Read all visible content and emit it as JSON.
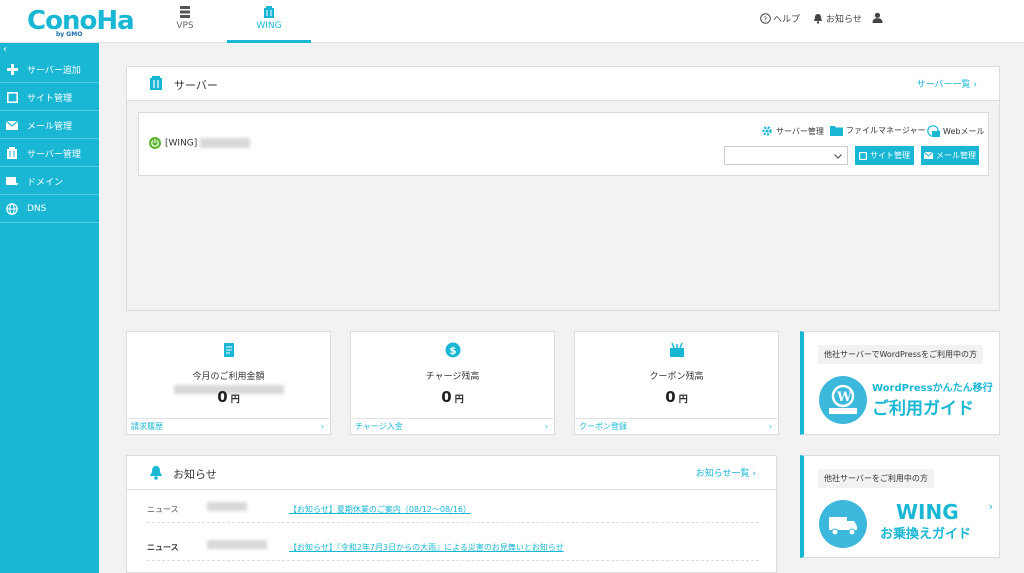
{
  "header": {
    "logo": "ConoHa",
    "logo_sub": "by GMO",
    "tabs": [
      {
        "label": "VPS",
        "icon": "server-rack-icon"
      },
      {
        "label": "WING",
        "icon": "wing-server-icon",
        "active": true
      }
    ],
    "help_label": "ヘルプ",
    "notice_label": "お知らせ"
  },
  "sidebar": {
    "items": [
      {
        "label": "サーバー追加",
        "icon": "plus-icon"
      },
      {
        "label": "サイト管理",
        "icon": "window-icon"
      },
      {
        "label": "メール管理",
        "icon": "envelope-icon"
      },
      {
        "label": "サーバー管理",
        "icon": "server-icon"
      },
      {
        "label": "ドメイン",
        "icon": "domain-icon"
      },
      {
        "label": "DNS",
        "icon": "globe-icon"
      }
    ]
  },
  "server": {
    "title": "サーバー",
    "list_link": "サーバー一覧 ›",
    "name_prefix": "[WING]",
    "links": {
      "server_manage": "サーバー管理",
      "file_manager": "ファイルマネージャー",
      "webmail": "Webメール"
    },
    "buttons": {
      "site_manage": "サイト管理",
      "mail_manage": "メール管理"
    },
    "select_value": ""
  },
  "cards": [
    {
      "label": "今月のご利用金額",
      "value": "0",
      "unit": "円",
      "footer": "請求履歴",
      "icon": "invoice-icon"
    },
    {
      "label": "チャージ残高",
      "value": "0",
      "unit": "円",
      "footer": "チャージ入金",
      "icon": "dollar-coin-icon"
    },
    {
      "label": "クーポン残高",
      "value": "0",
      "unit": "円",
      "footer": "クーポン登録",
      "icon": "coupon-icon"
    }
  ],
  "promos": [
    {
      "caption": "他社サーバーでWordPressをご利用中の方",
      "title_small": "WordPressかんたん移行",
      "title_big": "ご利用ガイド"
    },
    {
      "caption": "他社サーバーをご利用中の方",
      "title_small": "WING",
      "title_big": "お乗換えガイド"
    }
  ],
  "news": {
    "title": "お知らせ",
    "list_link": "お知らせ一覧 ›",
    "items": [
      {
        "category": "ニュース",
        "text": "【お知らせ】夏期休業のご案内（08/12〜08/16）"
      },
      {
        "category": "ニュース",
        "text": "【お知らせ】『令和2年7月3日からの大雨』による災害のお見舞いとお知らせ"
      }
    ]
  },
  "colors": {
    "accent": "#19b7d4",
    "status_ok": "#5cb531",
    "background": "#f2f2f2"
  }
}
